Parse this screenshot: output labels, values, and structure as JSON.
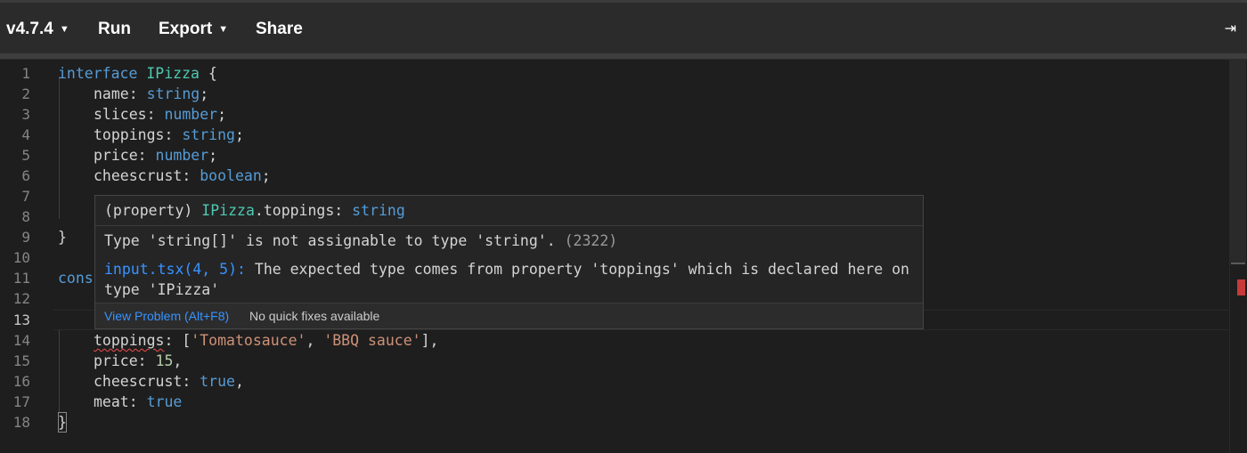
{
  "toolbar": {
    "version": "v4.7.4",
    "run": "Run",
    "export": "Export",
    "share": "Share",
    "collapse_icon": "⇥"
  },
  "editor": {
    "line_numbers": [
      "1",
      "2",
      "3",
      "4",
      "5",
      "6",
      "7",
      "8",
      "9",
      "10",
      "11",
      "12",
      "13",
      "14",
      "15",
      "16",
      "17",
      "18"
    ],
    "current_line": "13",
    "code": {
      "l1": {
        "kw": "interface",
        "name": "IPizza",
        "brace": " {"
      },
      "l2": {
        "prop": "name: ",
        "type": "string",
        "end": ";"
      },
      "l3": {
        "prop": "slices: ",
        "type": "number",
        "end": ";"
      },
      "l4": {
        "prop": "toppings: ",
        "type": "string",
        "end": ";"
      },
      "l5": {
        "prop": "price: ",
        "type": "number",
        "end": ";"
      },
      "l6": {
        "prop": "cheescrust: ",
        "type": "boolean",
        "end": ";"
      },
      "l9": "}",
      "l11": {
        "kw": "cons"
      },
      "l14": {
        "prop": "toppings",
        "mid": ": [",
        "s1": "'Tomatosauce'",
        "sep": ", ",
        "s2": "'BBQ sauce'",
        "end": "],"
      },
      "l15": {
        "prop": "price: ",
        "num": "15",
        "end": ","
      },
      "l16": {
        "prop": "cheescrust: ",
        "kw": "true",
        "end": ","
      },
      "l17": {
        "prop": "meat: ",
        "kw": "true"
      },
      "l18": "}"
    }
  },
  "hover": {
    "signature": {
      "prefix": "(property) ",
      "type": "IPizza",
      "member": ".toppings: ",
      "ret": "string"
    },
    "message": "Type 'string[]' is not assignable to type 'string'.",
    "code": "(2322)",
    "related_link": "input.tsx(4, 5):",
    "related_text": " The expected type comes from property 'toppings' which is declared here on type 'IPizza'",
    "view_problem": "View Problem (Alt+F8)",
    "no_fixes": "No quick fixes available"
  }
}
